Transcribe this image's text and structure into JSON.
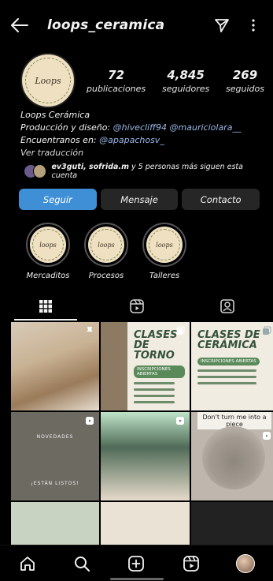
{
  "header": {
    "username": "loops_ceramica",
    "icons": [
      "back-arrow-icon",
      "direct-message-icon",
      "more-vertical-icon"
    ]
  },
  "profile": {
    "avatar_text": "Loops",
    "stats": [
      {
        "value": "72",
        "label": "publicaciones"
      },
      {
        "value": "4,845",
        "label": "seguidores"
      },
      {
        "value": "269",
        "label": "seguidos"
      }
    ],
    "bio": {
      "name": "Loops Cerámica",
      "line2_prefix": "Producción y diseño: ",
      "line2_link1": "@hivecliff94",
      "line2_link2": "@mauriciolara__",
      "line3_prefix": "Encuentranos en: ",
      "line3_link": "@apapachosv_",
      "translate": "Ver traducción"
    },
    "followed_by": {
      "names": "ev3guti, sofrida.m",
      "rest": " y 5 personas más siguen esta cuenta"
    }
  },
  "buttons": {
    "follow": "Seguir",
    "message": "Mensaje",
    "contact": "Contacto"
  },
  "highlights": [
    {
      "label": "Mercaditos",
      "text": "loops"
    },
    {
      "label": "Procesos",
      "text": "loops"
    },
    {
      "label": "Talleres",
      "text": "loops"
    }
  ],
  "tabs": [
    "grid-icon",
    "reels-icon",
    "tagged-icon"
  ],
  "grid": {
    "post2_title": "CLASES DE TORNO",
    "post2_badge": "INSCRIPCIONES ABIERTAS",
    "post3_title": "CLASES DE CERÁMICA",
    "post3_badge": "INSCRIPCIONES ABIERTAS",
    "post4_top": "NOVEDADES",
    "post4_bottom": "¡ESTÁN LISTOS!",
    "post6_tagline": "Don't turn me into a piece"
  },
  "colors": {
    "accent": "#3f8fd6",
    "background": "#000000",
    "link": "#9ab7e6"
  }
}
